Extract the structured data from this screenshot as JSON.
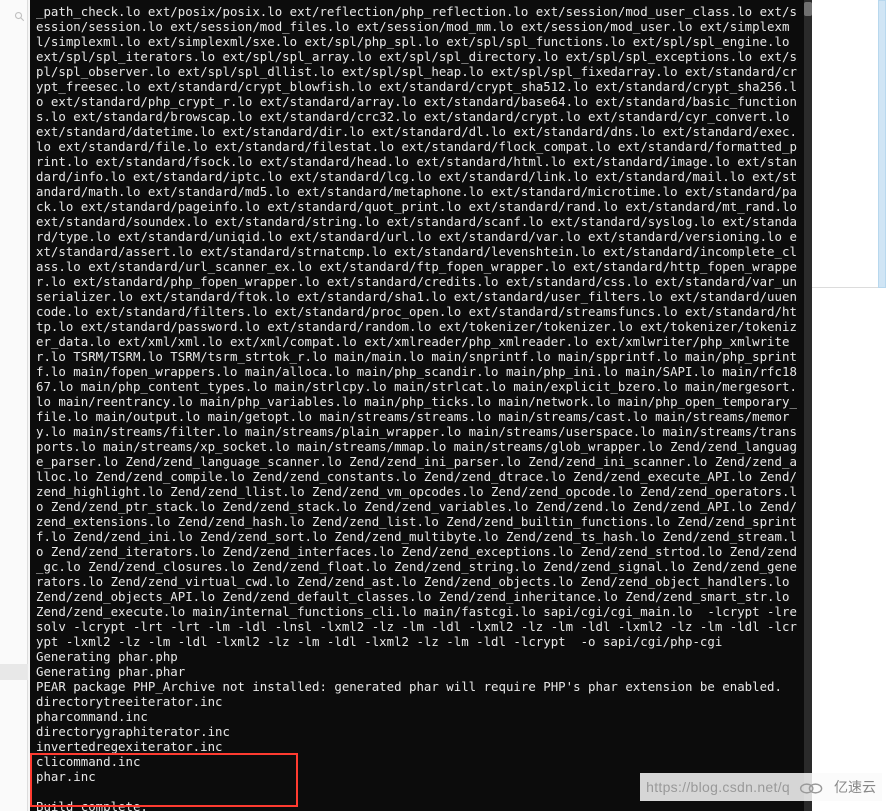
{
  "terminal": {
    "build_output": "_path_check.lo ext/posix/posix.lo ext/reflection/php_reflection.lo ext/session/mod_user_class.lo ext/session/session.lo ext/session/mod_files.lo ext/session/mod_mm.lo ext/session/mod_user.lo ext/simplexml/simplexml.lo ext/simplexml/sxe.lo ext/spl/php_spl.lo ext/spl/spl_functions.lo ext/spl/spl_engine.lo ext/spl/spl_iterators.lo ext/spl/spl_array.lo ext/spl/spl_directory.lo ext/spl/spl_exceptions.lo ext/spl/spl_observer.lo ext/spl/spl_dllist.lo ext/spl/spl_heap.lo ext/spl/spl_fixedarray.lo ext/standard/crypt_freesec.lo ext/standard/crypt_blowfish.lo ext/standard/crypt_sha512.lo ext/standard/crypt_sha256.lo ext/standard/php_crypt_r.lo ext/standard/array.lo ext/standard/base64.lo ext/standard/basic_functions.lo ext/standard/browscap.lo ext/standard/crc32.lo ext/standard/crypt.lo ext/standard/cyr_convert.lo ext/standard/datetime.lo ext/standard/dir.lo ext/standard/dl.lo ext/standard/dns.lo ext/standard/exec.lo ext/standard/file.lo ext/standard/filestat.lo ext/standard/flock_compat.lo ext/standard/formatted_print.lo ext/standard/fsock.lo ext/standard/head.lo ext/standard/html.lo ext/standard/image.lo ext/standard/info.lo ext/standard/iptc.lo ext/standard/lcg.lo ext/standard/link.lo ext/standard/mail.lo ext/standard/math.lo ext/standard/md5.lo ext/standard/metaphone.lo ext/standard/microtime.lo ext/standard/pack.lo ext/standard/pageinfo.lo ext/standard/quot_print.lo ext/standard/rand.lo ext/standard/mt_rand.lo ext/standard/soundex.lo ext/standard/string.lo ext/standard/scanf.lo ext/standard/syslog.lo ext/standard/type.lo ext/standard/uniqid.lo ext/standard/url.lo ext/standard/var.lo ext/standard/versioning.lo ext/standard/assert.lo ext/standard/strnatcmp.lo ext/standard/levenshtein.lo ext/standard/incomplete_class.lo ext/standard/url_scanner_ex.lo ext/standard/ftp_fopen_wrapper.lo ext/standard/http_fopen_wrapper.lo ext/standard/php_fopen_wrapper.lo ext/standard/credits.lo ext/standard/css.lo ext/standard/var_unserializer.lo ext/standard/ftok.lo ext/standard/sha1.lo ext/standard/user_filters.lo ext/standard/uuencode.lo ext/standard/filters.lo ext/standard/proc_open.lo ext/standard/streamsfuncs.lo ext/standard/http.lo ext/standard/password.lo ext/standard/random.lo ext/tokenizer/tokenizer.lo ext/tokenizer/tokenizer_data.lo ext/xml/xml.lo ext/xml/compat.lo ext/xmlreader/php_xmlreader.lo ext/xmlwriter/php_xmlwriter.lo TSRM/TSRM.lo TSRM/tsrm_strtok_r.lo main/main.lo main/snprintf.lo main/spprintf.lo main/php_sprintf.lo main/fopen_wrappers.lo main/alloca.lo main/php_scandir.lo main/php_ini.lo main/SAPI.lo main/rfc1867.lo main/php_content_types.lo main/strlcpy.lo main/strlcat.lo main/explicit_bzero.lo main/mergesort.lo main/reentrancy.lo main/php_variables.lo main/php_ticks.lo main/network.lo main/php_open_temporary_file.lo main/output.lo main/getopt.lo main/streams/streams.lo main/streams/cast.lo main/streams/memory.lo main/streams/filter.lo main/streams/plain_wrapper.lo main/streams/userspace.lo main/streams/transports.lo main/streams/xp_socket.lo main/streams/mmap.lo main/streams/glob_wrapper.lo Zend/zend_language_parser.lo Zend/zend_language_scanner.lo Zend/zend_ini_parser.lo Zend/zend_ini_scanner.lo Zend/zend_alloc.lo Zend/zend_compile.lo Zend/zend_constants.lo Zend/zend_dtrace.lo Zend/zend_execute_API.lo Zend/zend_highlight.lo Zend/zend_llist.lo Zend/zend_vm_opcodes.lo Zend/zend_opcode.lo Zend/zend_operators.lo Zend/zend_ptr_stack.lo Zend/zend_stack.lo Zend/zend_variables.lo Zend/zend.lo Zend/zend_API.lo Zend/zend_extensions.lo Zend/zend_hash.lo Zend/zend_list.lo Zend/zend_builtin_functions.lo Zend/zend_sprintf.lo Zend/zend_ini.lo Zend/zend_sort.lo Zend/zend_multibyte.lo Zend/zend_ts_hash.lo Zend/zend_stream.lo Zend/zend_iterators.lo Zend/zend_interfaces.lo Zend/zend_exceptions.lo Zend/zend_strtod.lo Zend/zend_gc.lo Zend/zend_closures.lo Zend/zend_float.lo Zend/zend_string.lo Zend/zend_signal.lo Zend/zend_generators.lo Zend/zend_virtual_cwd.lo Zend/zend_ast.lo Zend/zend_objects.lo Zend/zend_object_handlers.lo Zend/zend_objects_API.lo Zend/zend_default_classes.lo Zend/zend_inheritance.lo Zend/zend_smart_str.lo Zend/zend_execute.lo main/internal_functions_cli.lo main/fastcgi.lo sapi/cgi/cgi_main.lo  -lcrypt -lresolv -lcrypt -lrt -lrt -lm -ldl -lnsl -lxml2 -lz -lm -ldl -lxml2 -lz -lm -ldl -lxml2 -lz -lm -ldl -lcrypt -lxml2 -lz -lm -ldl -lxml2 -lz -lm -ldl -lxml2 -lz -lm -ldl -lcrypt  -o sapi/cgi/php-cgi\nGenerating phar.php\nGenerating phar.phar\nPEAR package PHP_Archive not installed: generated phar will require PHP's phar extension be enabled.\ndirectorytreeiterator.inc\npharcommand.inc\ndirectorygraphiterator.inc\ninvertedregexiterator.inc\nclicommand.inc\nphar.inc\n\nBuild complete.\nDon't forget to run 'make test'.\n"
  },
  "watermark": {
    "url": "https://blog.csdn.net/q",
    "brand": "亿速云"
  }
}
